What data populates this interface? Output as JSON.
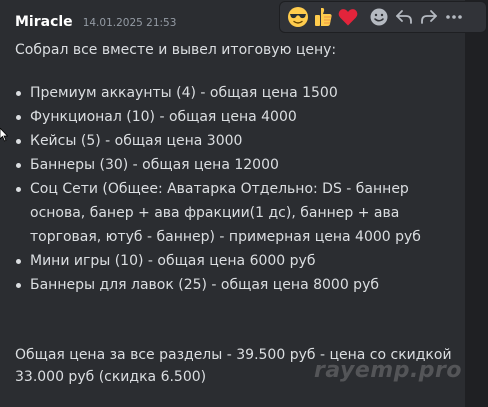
{
  "message": {
    "author": "Miracle",
    "timestamp": "14.01.2025 21:53",
    "intro": "Собрал все вместе и вывел итоговую цену:",
    "items": [
      "Премиум аккаунты (4) - общая цена 1500",
      "Функционал (10) - общая цена 4000",
      "Кейсы (5) - общая цена 3000",
      "Баннеры (30) - общая цена 12000",
      "Соц Сети (Общее: Аватарка   Отдельно: DS - баннер основа, банер + ава фракции(1 дс), баннер + ава торговая, ютуб - баннер) - примерная цена 4000 руб",
      "Мини игры (10) - общая цена 6000 руб",
      "Баннеры для лавок (25) - общая цена 8000 руб"
    ],
    "total": "Общая цена за все разделы - 39.500 руб - цена со скидкой 33.000 руб (скидка 6.500)"
  },
  "toolbar": {
    "reactions": [
      "sunglasses-emoji",
      "thumbs-up-emoji",
      "red-heart-emoji"
    ],
    "actions": [
      "add-reaction",
      "reply",
      "forward",
      "more"
    ]
  },
  "watermark": "rayemp.pro",
  "colors": {
    "background": "#2b2d31",
    "toolbar": "#313338",
    "text": "#dbdee1",
    "muted": "#949ba4",
    "heart": "#e3243b",
    "emoji_yellow": "#ffcc4d"
  }
}
